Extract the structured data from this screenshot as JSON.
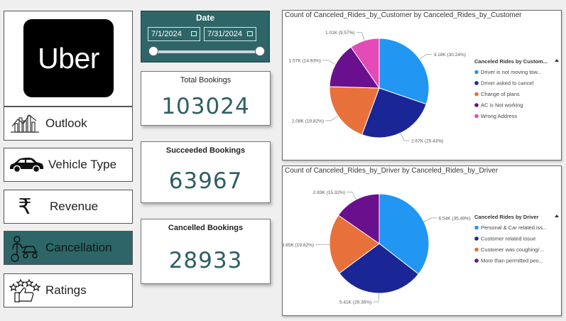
{
  "logo": {
    "text": "Uber"
  },
  "nav": [
    {
      "label": "Outlook",
      "icon": "bar-chart-icon",
      "active": false
    },
    {
      "label": "Vehicle Type",
      "icon": "car-icon",
      "active": false
    },
    {
      "label": "Revenue",
      "icon": "rupee-icon",
      "active": false
    },
    {
      "label": "Cancellation",
      "icon": "mechanic-icon",
      "active": true
    },
    {
      "label": "Ratings",
      "icon": "thumbs-up-stars-icon",
      "active": false
    }
  ],
  "date_slicer": {
    "title": "Date",
    "start": "7/1/2024",
    "end": "7/31/2024"
  },
  "kpis": {
    "total": {
      "label": "Total Bookings",
      "value": "103024"
    },
    "succeeded": {
      "label": "Succeeded Bookings",
      "value": "63967"
    },
    "cancelled": {
      "label": "Cancelled Bookings",
      "value": "28933"
    }
  },
  "colors": {
    "teal": "#2d6568",
    "blue": "#2196f3",
    "navy": "#1a2596",
    "orange": "#e8703a",
    "purple": "#6a0f8e",
    "pink": "#e54bb7"
  },
  "chart_data": [
    {
      "type": "pie",
      "title": "Count of Canceled_Rides_by_Customer by Canceled_Rides_by_Customer",
      "legend_title": "Canceled Rides by Custom...",
      "legend_position": "right",
      "slices": [
        {
          "name": "Driver is not moving tow...",
          "value": 3180,
          "label": "3.18K (30.24%)",
          "color": "#2196f3"
        },
        {
          "name": "Driver asked to cancel",
          "value": 2670,
          "label": "2.67K (25.43%)",
          "color": "#1a2596"
        },
        {
          "name": "Change of plans",
          "value": 2080,
          "label": "2.08K (19.82%)",
          "color": "#e8703a"
        },
        {
          "name": "AC is Not working",
          "value": 1570,
          "label": "1.57K (14.93%)",
          "color": "#6a0f8e"
        },
        {
          "name": "Wrong Address",
          "value": 1010,
          "label": "1.01K (9.57%)",
          "color": "#e54bb7"
        }
      ]
    },
    {
      "type": "pie",
      "title": "Count of Canceled_Rides_by_Driver by Canceled_Rides_by_Driver",
      "legend_title": "Canceled Rides by Driver",
      "legend_position": "right",
      "slices": [
        {
          "name": "Personal & Car related iss...",
          "value": 6540,
          "label": "6.54K (35.49%)",
          "color": "#2196f3"
        },
        {
          "name": "Customer related issue",
          "value": 5410,
          "label": "5.41K (29.36%)",
          "color": "#1a2596"
        },
        {
          "name": "Customer was coughing/...",
          "value": 3650,
          "label": "3.65K (19.82%)",
          "color": "#e8703a"
        },
        {
          "name": "More than permitted peo...",
          "value": 2830,
          "label": "2.83K (15.32%)",
          "color": "#6a0f8e"
        }
      ]
    }
  ]
}
